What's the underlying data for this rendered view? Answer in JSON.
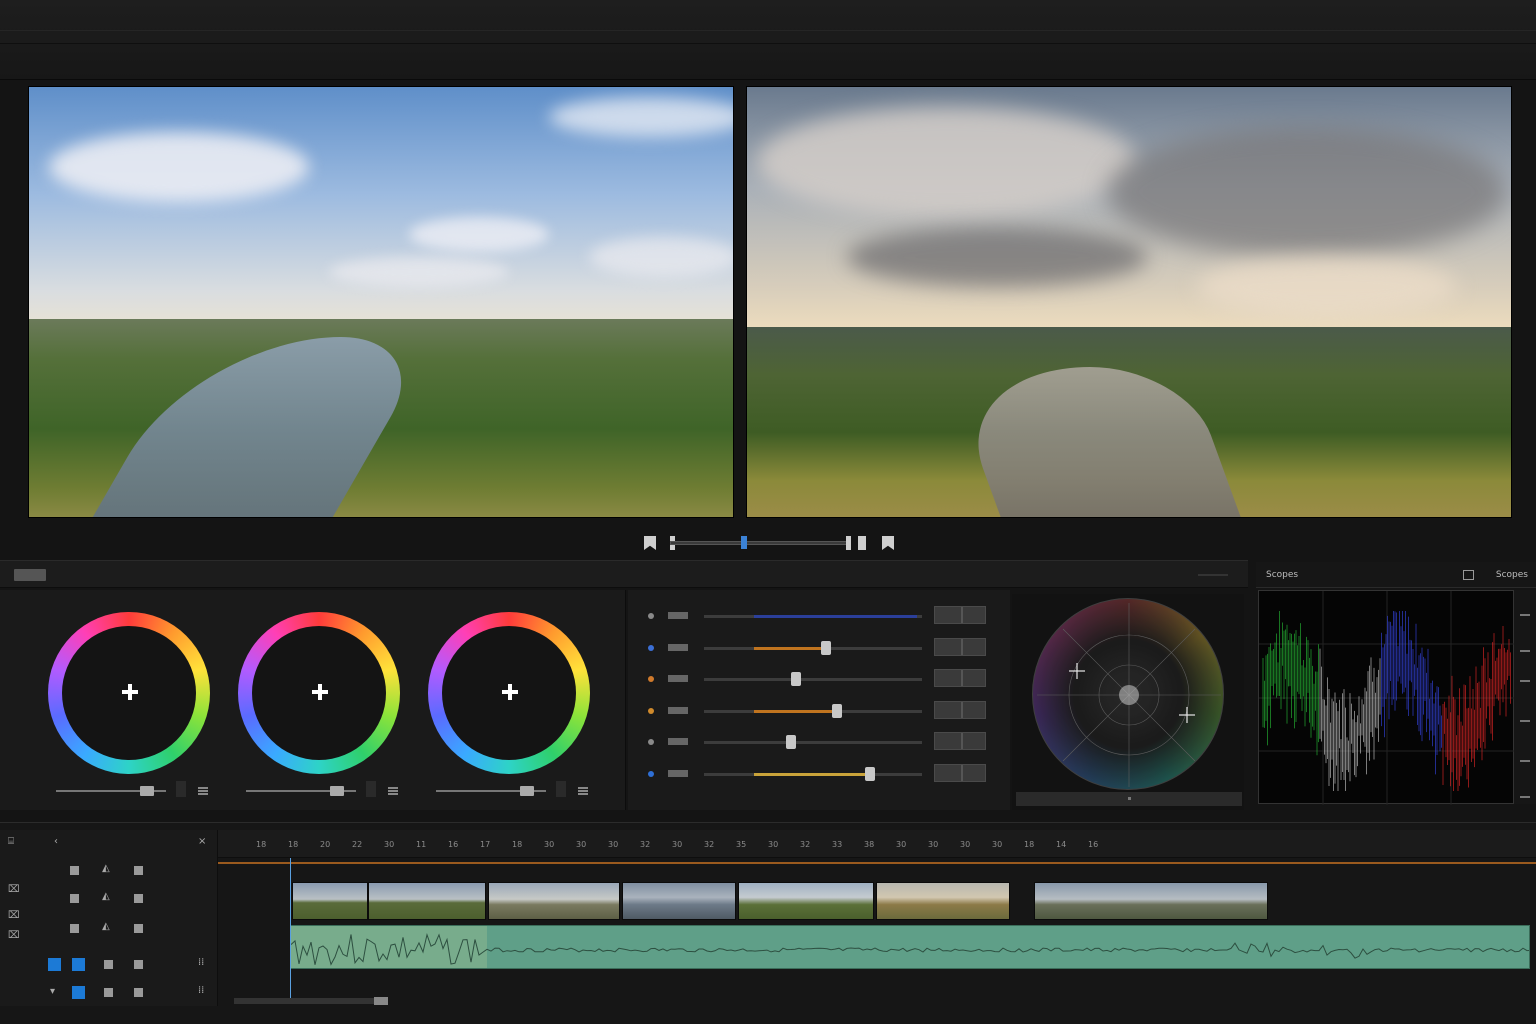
{
  "app": {
    "accent": "#3b82d6"
  },
  "viewers": {
    "source": {
      "name": "source-viewer"
    },
    "program": {
      "name": "program-viewer"
    }
  },
  "transport": {
    "icons": [
      "mark-in-icon",
      "scrub-bar",
      "mark-out-icon"
    ],
    "playhead_fraction": 0.4
  },
  "color_wheels": {
    "wheels": [
      {
        "name": "lift",
        "slider_fraction": 0.78
      },
      {
        "name": "gamma",
        "slider_fraction": 0.78
      },
      {
        "name": "gain",
        "slider_fraction": 0.78
      }
    ]
  },
  "adjust_sliders": [
    {
      "dot_color": "#8a8a8a",
      "value_fraction": 1.0,
      "fill": "#2b3f9a"
    },
    {
      "dot_color": "#3b6fd6",
      "value_fraction": 0.56,
      "fill": "#c0741f"
    },
    {
      "dot_color": "#d07a2c",
      "value_fraction": 0.42,
      "fill": ""
    },
    {
      "dot_color": "#d08a2c",
      "value_fraction": 0.61,
      "fill": "#c0741f"
    },
    {
      "dot_color": "#8a8a8a",
      "value_fraction": 0.4,
      "fill": ""
    },
    {
      "dot_color": "#2e6fd6",
      "value_fraction": 0.76,
      "fill": "#c9a33a"
    }
  ],
  "scopes": {
    "title": "Scopes",
    "mode": "Scopes",
    "waveform_colors": [
      "#29d13a",
      "#e0e0e0",
      "#3b4dff",
      "#ff2a2a"
    ]
  },
  "timeline": {
    "ruler_ticks": [
      "18",
      "18",
      "20",
      "22",
      "30",
      "11",
      "16",
      "17",
      "18",
      "30",
      "30",
      "30",
      "32",
      "30",
      "32",
      "35",
      "30",
      "32",
      "33",
      "38",
      "30",
      "30",
      "30",
      "30",
      "18",
      "14",
      "16"
    ],
    "clips": [
      {
        "thumb": "field-landscape"
      },
      {
        "thumb": "field-landscape"
      },
      {
        "thumb": "open-plain"
      },
      {
        "thumb": "lake-coast"
      },
      {
        "thumb": "green-valley"
      },
      {
        "thumb": "tree-meadow"
      },
      {
        "thumb": "village-horizon"
      }
    ]
  }
}
